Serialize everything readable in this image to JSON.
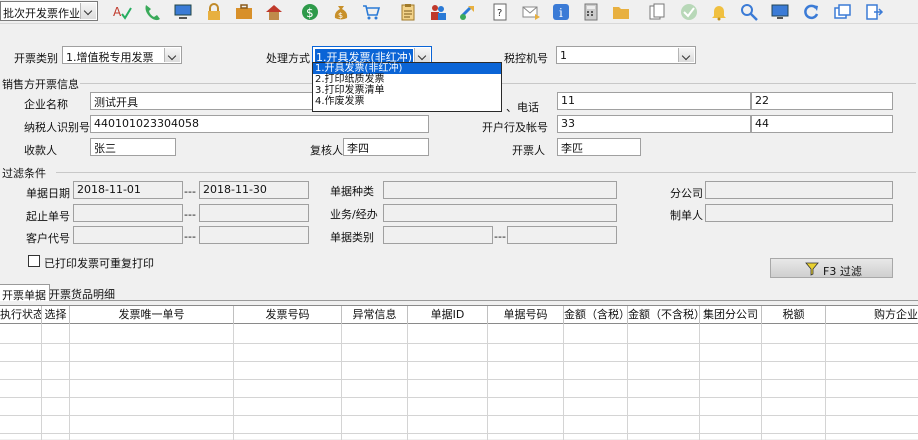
{
  "toolbar": {
    "mode_value": "批次开发票作业",
    "icons": [
      "spell-check-icon",
      "phone-icon",
      "computer-icon",
      "lock-icon",
      "briefcase-icon",
      "home-icon",
      "dollar-coin-icon",
      "money-bag-icon",
      "shopping-cart-icon",
      "clipboard-icon",
      "users-icon",
      "refresh-arrows-icon",
      "help-document-icon",
      "mail-icon",
      "info-icon",
      "calculator-icon",
      "folder-icon",
      "copy-document-icon",
      "check-circle-icon",
      "bell-icon",
      "search-icon",
      "monitor-icon",
      "reload-icon",
      "windows-icon",
      "exit-icon"
    ]
  },
  "header": {
    "invoice_type_label": "开票类别",
    "invoice_type_value": "1.增值税专用发票",
    "process_label": "处理方式",
    "process_value": "1.开具发票(非红冲)",
    "tax_machine_label": "税控机号",
    "tax_machine_value": "1"
  },
  "process_options": [
    "1.开具发票(非红冲)",
    "2.打印纸质发票",
    "3.打印发票清单",
    "4.作废发票"
  ],
  "seller": {
    "section_title": "销售方开票信息",
    "company_label": "企业名称",
    "company_value": "测试开具",
    "phone_label": "、电话",
    "phone_value1": "11",
    "phone_value2": "22",
    "taxpayer_label": "纳税人识别号",
    "taxpayer_value": "440101023304058",
    "bank_label": "开户行及帐号",
    "bank_value1": "33",
    "bank_value2": "44",
    "payee_label": "收款人",
    "payee_value": "张三",
    "reviewer_label": "复核人",
    "reviewer_value": "李四",
    "issuer_label": "开票人",
    "issuer_value": "李匹"
  },
  "filter": {
    "section_title": "过滤条件",
    "date_label": "单据日期",
    "date_from": "2018-11-01",
    "date_to": "2018-11-30",
    "range_sep": "---",
    "doc_kind_label": "单据种类",
    "branch_label": "分公司",
    "start_no_label": "起止单号",
    "salesman_label": "业务/经办",
    "maker_label": "制单人",
    "customer_label": "客户代号",
    "doc_type_label": "单据类别",
    "reprint_label": "已打印发票可重复打印",
    "filter_button": "F3 过滤"
  },
  "tabs": [
    "开票单据",
    "开票货品明细"
  ],
  "grid": {
    "columns": [
      "执行状态",
      "选择",
      "发票唯一单号",
      "发票号码",
      "异常信息",
      "单据ID",
      "单据号码",
      "金额（含税）",
      "金额（不含税）",
      "集团分公司",
      "税额",
      "购方企业"
    ]
  },
  "colors": {
    "selection": "#0a64d6",
    "toolbar_bg": "#f0f0f0"
  }
}
